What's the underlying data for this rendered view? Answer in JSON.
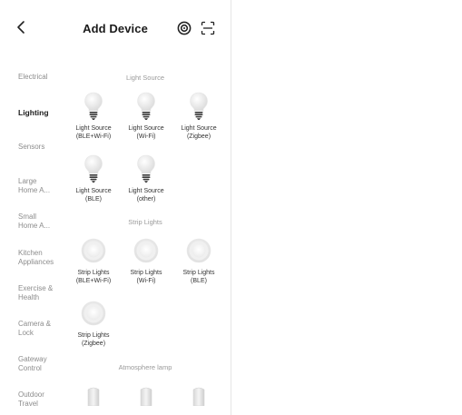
{
  "header": {
    "title": "Add Device",
    "icons": [
      "back-chevron-icon",
      "scan-ring-icon",
      "scan-frame-icon"
    ]
  },
  "sidebar": {
    "items": [
      {
        "label": "Electrical",
        "active": false
      },
      {
        "label": "Lighting",
        "active": true
      },
      {
        "label": "Sensors",
        "active": false
      },
      {
        "label": "Large\nHome A...",
        "active": false
      },
      {
        "label": "Small\nHome A...",
        "active": false
      },
      {
        "label": "Kitchen\nAppliances",
        "active": false
      },
      {
        "label": "Exercise &\nHealth",
        "active": false
      },
      {
        "label": "Camera &\nLock",
        "active": false
      },
      {
        "label": "Gateway\nControl",
        "active": false
      },
      {
        "label": "Outdoor\nTravel",
        "active": false
      }
    ]
  },
  "content": {
    "sections": [
      {
        "title": "Light Source",
        "devices": [
          {
            "label": "Light Source\n(BLE+Wi-Fi)",
            "icon": "bulb-icon"
          },
          {
            "label": "Light Source\n(Wi-Fi)",
            "icon": "bulb-icon"
          },
          {
            "label": "Light Source\n(Zigbee)",
            "icon": "bulb-icon"
          },
          {
            "label": "Light Source\n(BLE)",
            "icon": "bulb-icon"
          },
          {
            "label": "Light Source\n(other)",
            "icon": "bulb-icon"
          }
        ]
      },
      {
        "title": "Strip Lights",
        "devices": [
          {
            "label": "Strip Lights\n(BLE+Wi-Fi)",
            "icon": "strip-light-icon"
          },
          {
            "label": "Strip Lights\n(Wi-Fi)",
            "icon": "strip-light-icon"
          },
          {
            "label": "Strip Lights\n(BLE)",
            "icon": "strip-light-icon"
          },
          {
            "label": "Strip Lights\n(Zigbee)",
            "icon": "strip-light-icon"
          }
        ]
      },
      {
        "title": "Atmosphere lamp",
        "devices": [
          {
            "label": "",
            "icon": "atmosphere-lamp-icon"
          },
          {
            "label": "",
            "icon": "atmosphere-lamp-icon"
          },
          {
            "label": "",
            "icon": "atmosphere-lamp-icon"
          }
        ]
      }
    ]
  }
}
